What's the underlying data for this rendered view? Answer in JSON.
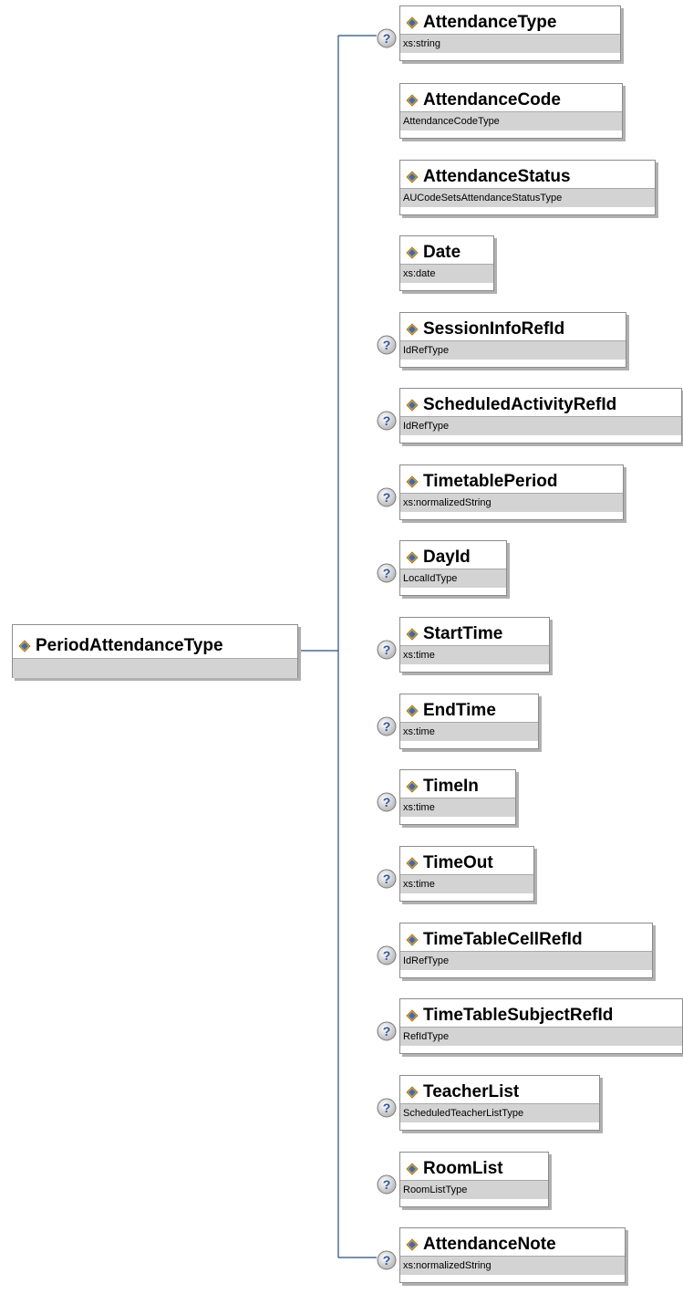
{
  "root": {
    "name": "PeriodAttendanceType",
    "type": "",
    "icon": "element-icon"
  },
  "optional_icon": "optional-question-icon",
  "colors": {
    "connector": "#1f4e8c",
    "type_band": "#d3d3d3",
    "border": "#8c8c8c"
  },
  "elements": [
    {
      "name": "AttendanceType",
      "type": "xs:string",
      "optional": true
    },
    {
      "name": "AttendanceCode",
      "type": "AttendanceCodeType",
      "optional": false
    },
    {
      "name": "AttendanceStatus",
      "type": "AUCodeSetsAttendanceStatusType",
      "optional": false
    },
    {
      "name": "Date",
      "type": "xs:date",
      "optional": false
    },
    {
      "name": "SessionInfoRefId",
      "type": "IdRefType",
      "optional": true
    },
    {
      "name": "ScheduledActivityRefId",
      "type": "IdRefType",
      "optional": true
    },
    {
      "name": "TimetablePeriod",
      "type": "xs:normalizedString",
      "optional": true
    },
    {
      "name": "DayId",
      "type": "LocalIdType",
      "optional": true
    },
    {
      "name": "StartTime",
      "type": "xs:time",
      "optional": true
    },
    {
      "name": "EndTime",
      "type": "xs:time",
      "optional": true
    },
    {
      "name": "TimeIn",
      "type": "xs:time",
      "optional": true
    },
    {
      "name": "TimeOut",
      "type": "xs:time",
      "optional": true
    },
    {
      "name": "TimeTableCellRefId",
      "type": "IdRefType",
      "optional": true
    },
    {
      "name": "TimeTableSubjectRefId",
      "type": "RefIdType",
      "optional": true
    },
    {
      "name": "TeacherList",
      "type": "ScheduledTeacherListType",
      "optional": true
    },
    {
      "name": "RoomList",
      "type": "RoomListType",
      "optional": true
    },
    {
      "name": "AttendanceNote",
      "type": "xs:normalizedString",
      "optional": true
    }
  ]
}
